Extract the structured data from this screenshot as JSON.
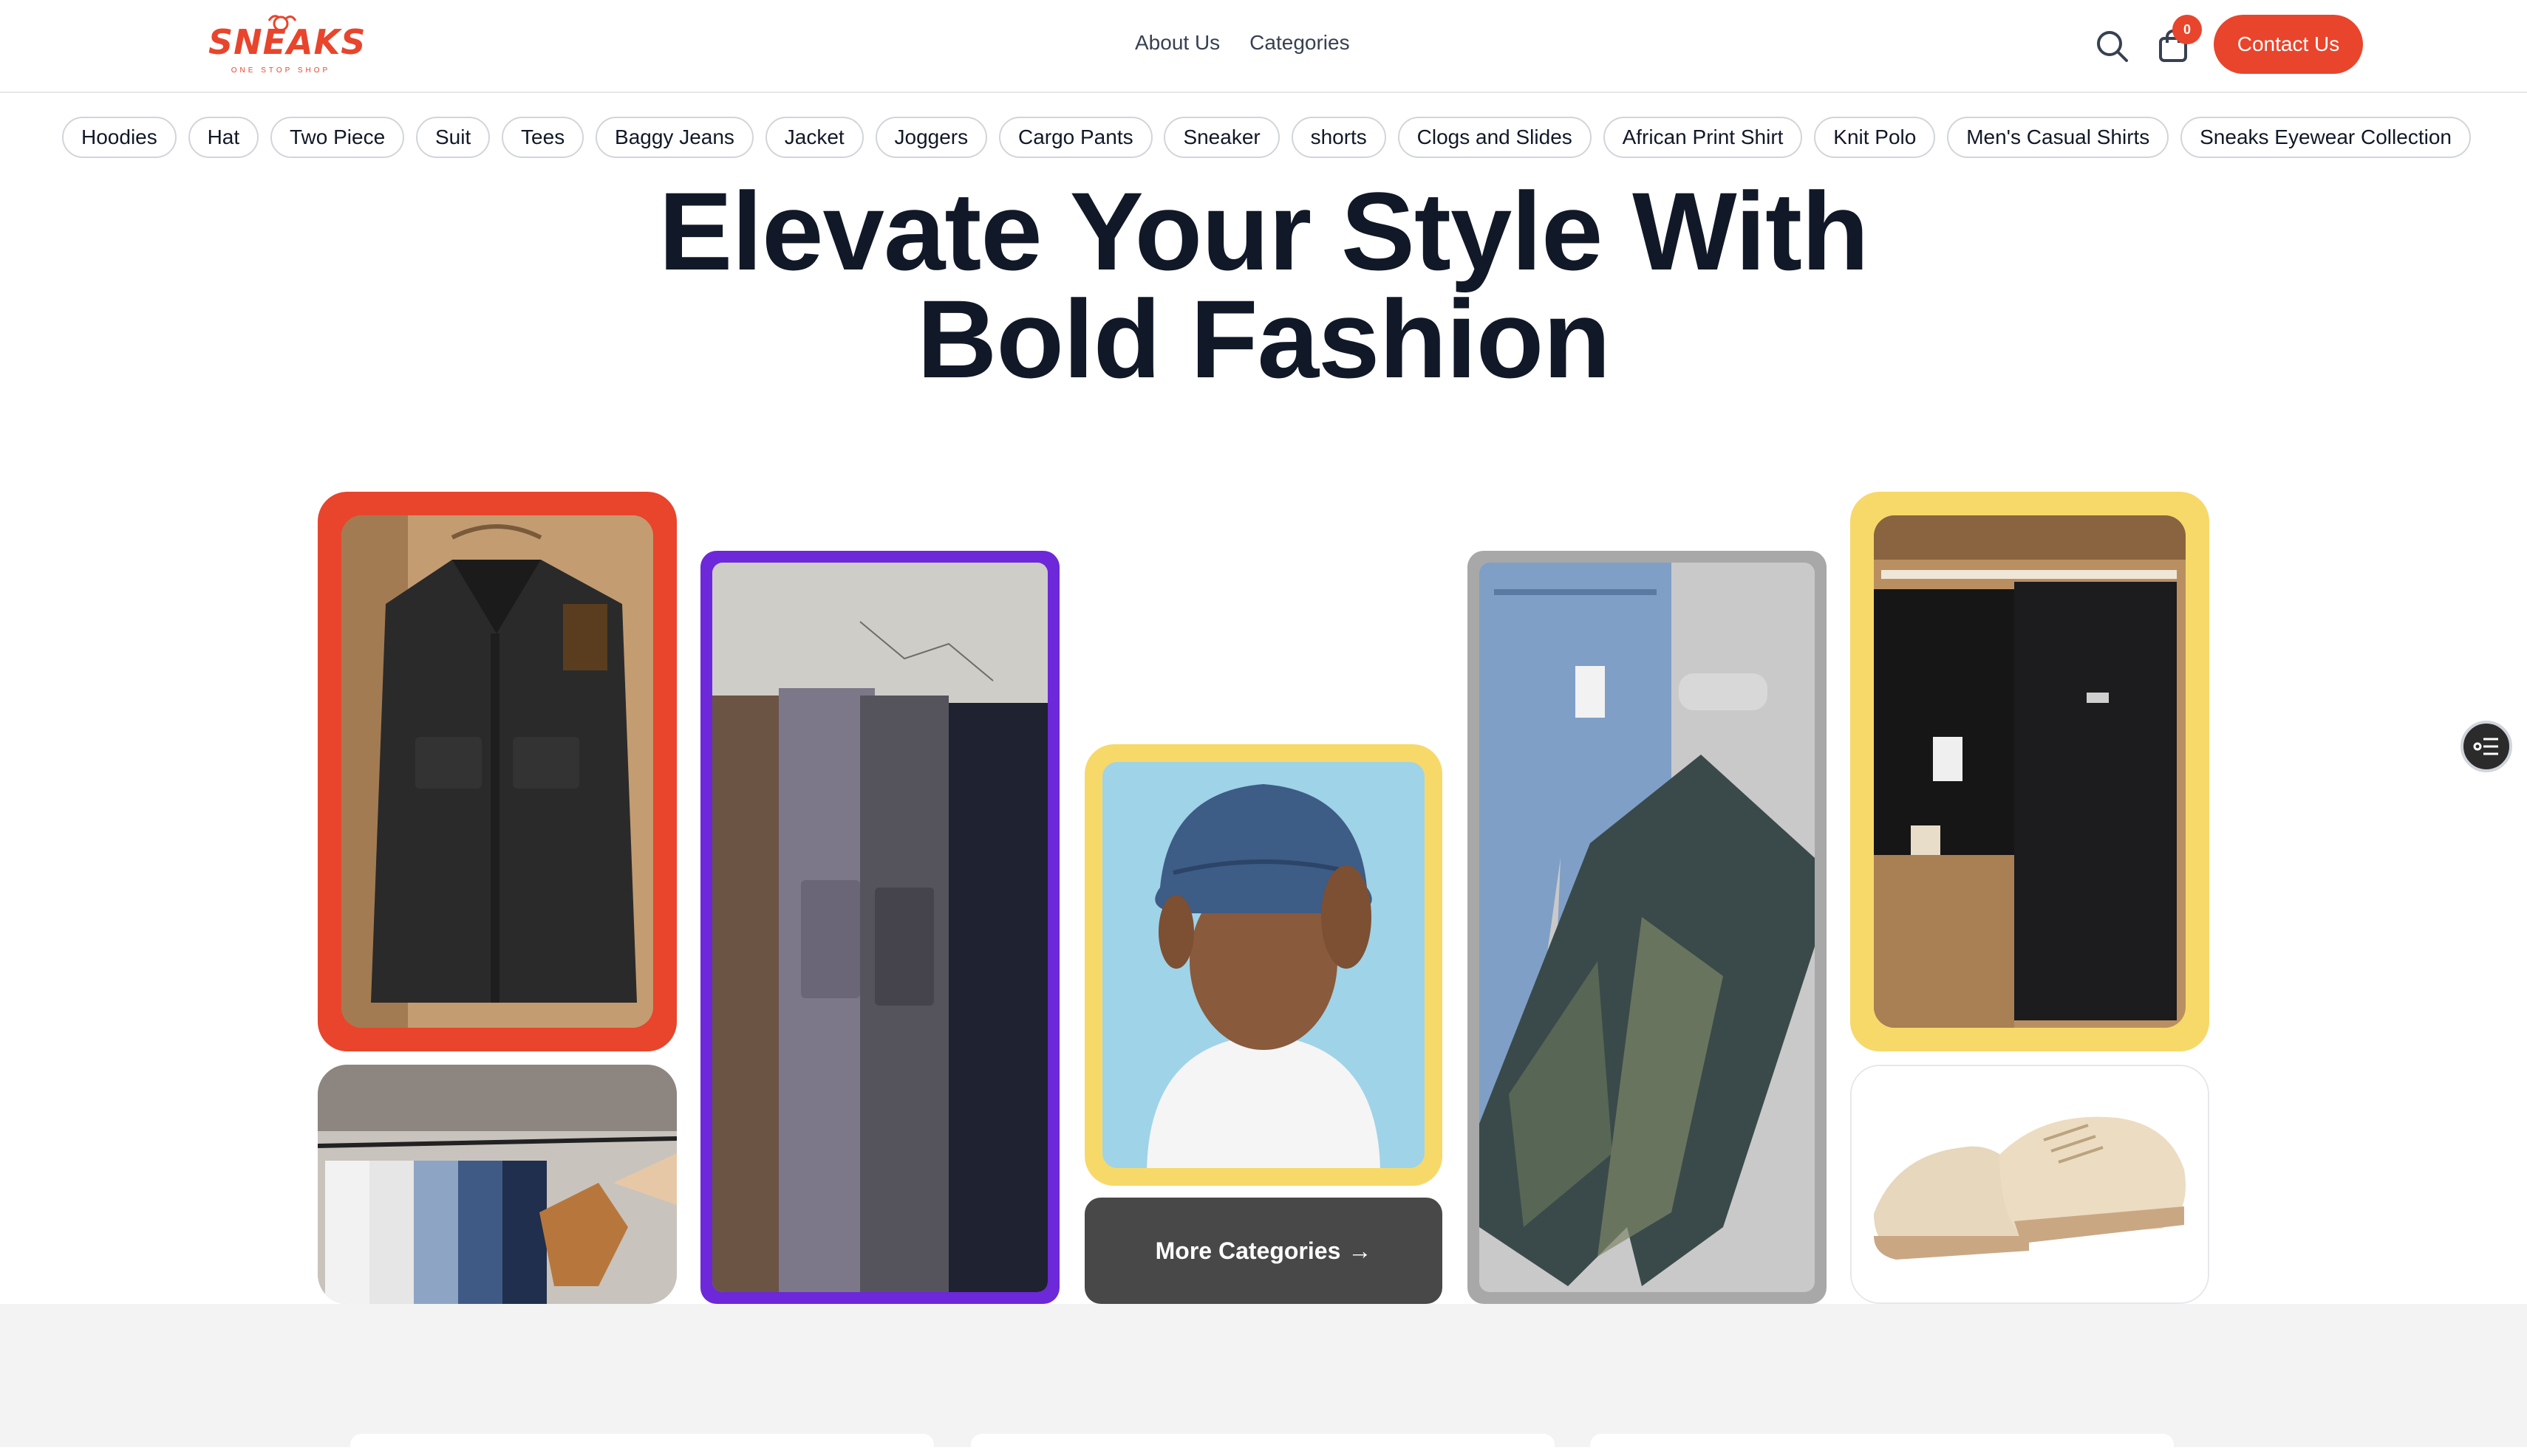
{
  "header": {
    "logo_text": "SNEAKS",
    "logo_tagline": "ONE STOP SHOP",
    "nav": [
      "About Us",
      "Categories"
    ],
    "cart_count": "0",
    "contact_label": "Contact Us"
  },
  "categories": [
    "Hoodies",
    "Hat",
    "Two Piece",
    "Suit",
    "Tees",
    "Baggy Jeans",
    "Jacket",
    "Joggers",
    "Cargo Pants",
    "Sneaker",
    "shorts",
    "Clogs and Slides",
    "African Print Shirt",
    "Knit Polo",
    "Men's Casual Shirts",
    "Sneaks Eyewear Collection"
  ],
  "hero": {
    "line1": "Elevate Your Style With",
    "line2": "Bold Fashion"
  },
  "grid": {
    "more_label": "More Categories",
    "more_arrow": "→"
  },
  "colors": {
    "accent": "#e8452c",
    "purple": "#6d28d9",
    "yellow": "#f7d96a",
    "gray_border": "#a8a8a8",
    "dark_button": "#484848"
  },
  "icons": [
    "search-icon",
    "shopping-bag-icon",
    "list-settings-icon",
    "arrow-right-icon"
  ]
}
